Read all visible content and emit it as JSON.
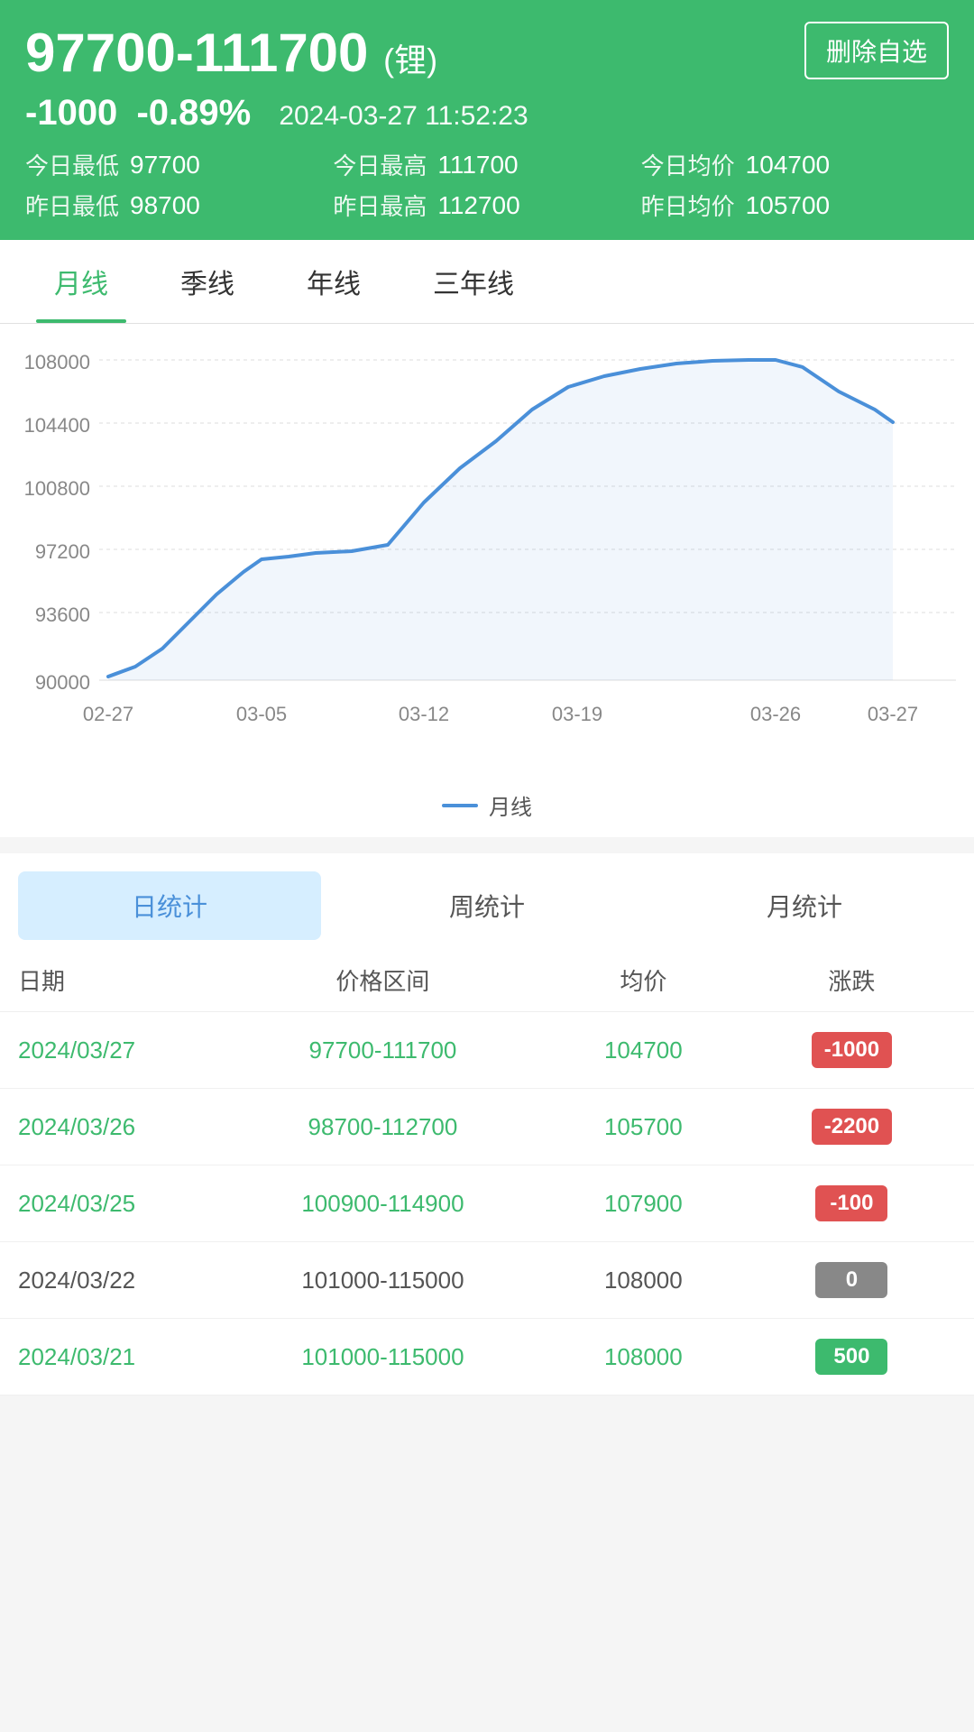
{
  "header": {
    "price_range": "97700-111700",
    "unit": "(锂)",
    "delete_btn": "删除自选",
    "change": "-1000",
    "change_pct": "-0.89%",
    "datetime": "2024-03-27 11:52:23",
    "stats": [
      {
        "label": "今日最低",
        "value": "97700"
      },
      {
        "label": "今日最高",
        "value": "111700"
      },
      {
        "label": "今日均价",
        "value": "104700"
      },
      {
        "label": "昨日最低",
        "value": "98700"
      },
      {
        "label": "昨日最高",
        "value": "112700"
      },
      {
        "label": "昨日均价",
        "value": "105700"
      }
    ]
  },
  "chart_tabs": [
    "月线",
    "季线",
    "年线",
    "三年线"
  ],
  "chart_legend": "月线",
  "chart": {
    "x_labels": [
      "02-27",
      "03-05",
      "03-12",
      "03-19",
      "03-26",
      "03-27"
    ],
    "y_labels": [
      "108000",
      "104400",
      "100800",
      "97200",
      "93600",
      "90000"
    ],
    "color": "#4a90d9"
  },
  "stats_tabs": [
    "日统计",
    "周统计",
    "月统计"
  ],
  "table": {
    "headers": [
      "日期",
      "价格区间",
      "均价",
      "涨跌"
    ],
    "rows": [
      {
        "date": "2024/03/27",
        "range": "97700-111700",
        "avg": "104700",
        "change": "-1000",
        "type": "red",
        "style": "green"
      },
      {
        "date": "2024/03/26",
        "range": "98700-112700",
        "avg": "105700",
        "change": "-2200",
        "type": "red",
        "style": "green"
      },
      {
        "date": "2024/03/25",
        "range": "100900-114900",
        "avg": "107900",
        "change": "-100",
        "type": "red",
        "style": "green"
      },
      {
        "date": "2024/03/22",
        "range": "101000-115000",
        "avg": "108000",
        "change": "0",
        "type": "gray",
        "style": "gray"
      },
      {
        "date": "2024/03/21",
        "range": "101000-115000",
        "avg": "108000",
        "change": "500",
        "type": "green",
        "style": "green"
      }
    ]
  }
}
